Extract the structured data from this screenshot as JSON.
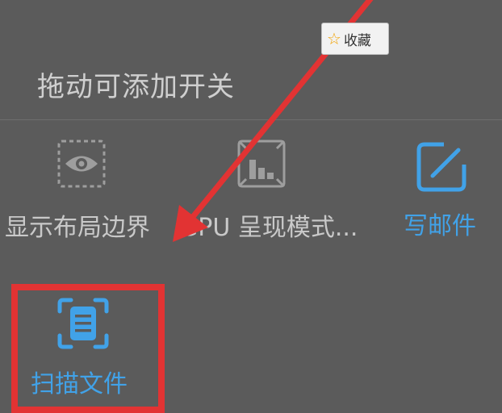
{
  "favorite_chip": {
    "icon": "star-outline-icon",
    "label": "收藏"
  },
  "section_header": "拖动可添加开关",
  "tiles": [
    {
      "id": "show-layout-bounds",
      "label": "显示布局边界",
      "icon": "eye-icon",
      "label_color": "#c9c9c9"
    },
    {
      "id": "gpu-rendering",
      "label": "GPU 呈现模式...",
      "icon": "gpu-bar-chart-icon",
      "label_color": "#c9c9c9"
    },
    {
      "id": "write-email",
      "label": "写邮件",
      "icon": "compose-icon",
      "label_color": "#41a2e8"
    },
    {
      "id": "scan-document",
      "label": "扫描文件",
      "icon": "scan-document-icon",
      "label_color": "#41a2e8"
    }
  ],
  "colors": {
    "background": "#5b5b5b",
    "accent_blue": "#41a2e8",
    "annotation_red": "#e23333",
    "icon_gray": "#9e9e9e"
  }
}
